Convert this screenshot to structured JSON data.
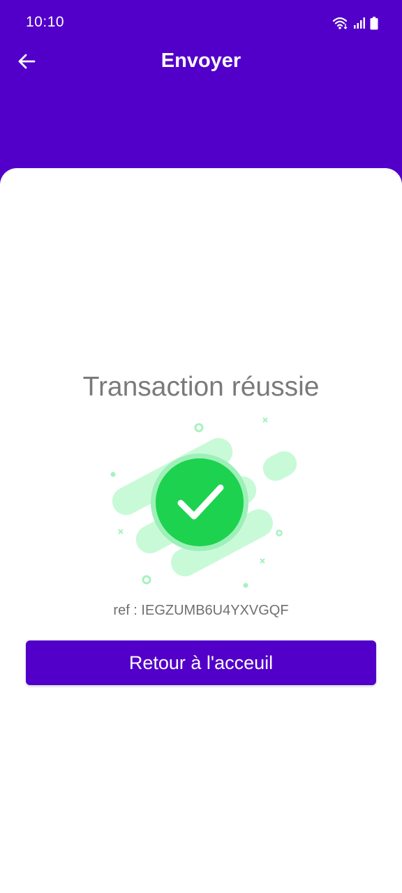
{
  "status_bar": {
    "time": "10:10",
    "icons": [
      "wifi-icon",
      "signal-icon",
      "battery-icon"
    ]
  },
  "toolbar": {
    "back_icon": "arrow-left-icon",
    "title": "Envoyer"
  },
  "result": {
    "title": "Transaction réussie",
    "icon": "check-circle-icon",
    "ref": "ref : IEGZUMB6U4YXVGQF"
  },
  "actions": {
    "home_label": "Retour à l'acceuil"
  },
  "colors": {
    "primary": "#5200C9",
    "success": "#1DD24E",
    "success_light": "#C9FAD8",
    "text_gray": "#7a7a7a"
  }
}
